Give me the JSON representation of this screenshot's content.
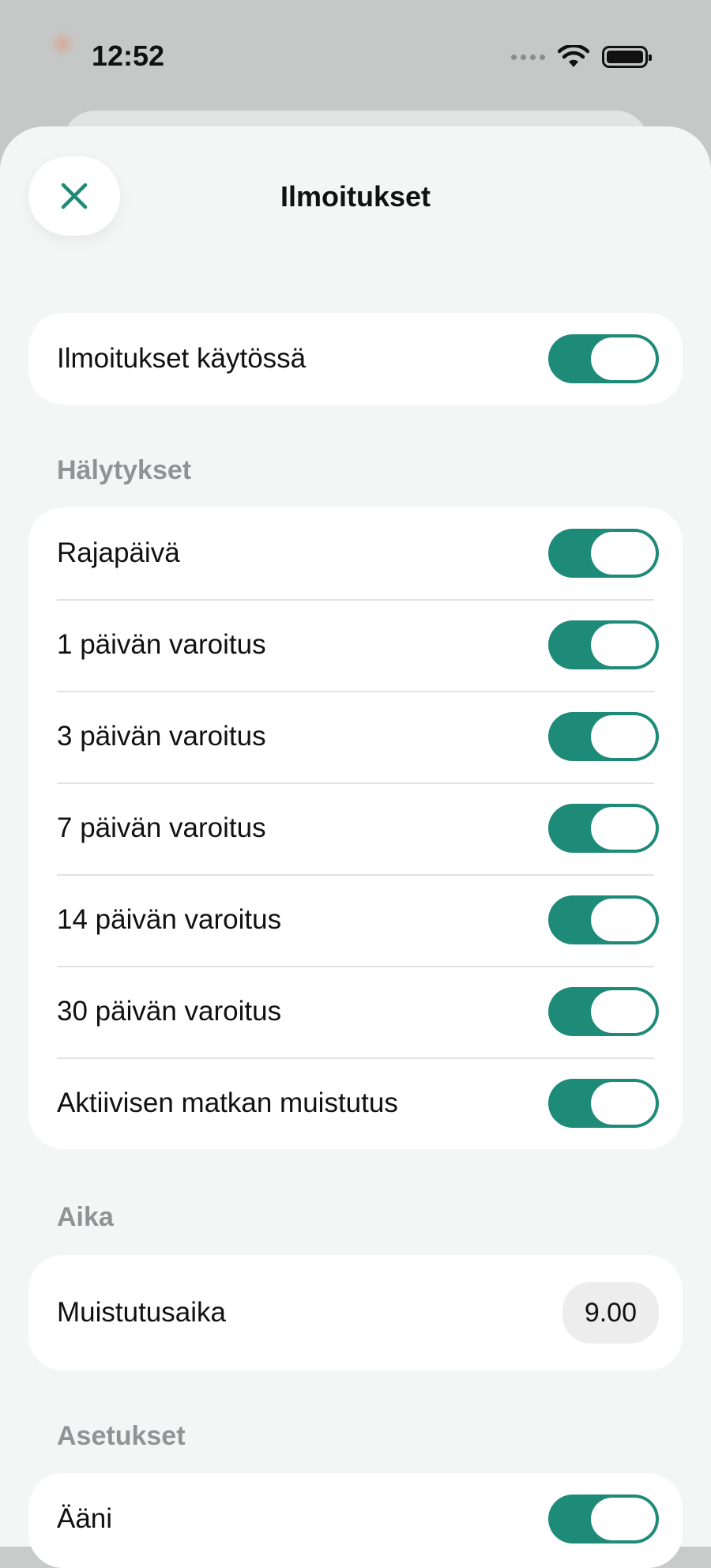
{
  "status_bar": {
    "time": "12:52"
  },
  "sheet": {
    "title": "Ilmoitukset",
    "close_icon": "close-icon",
    "accent_color": "#1e8a78"
  },
  "master": {
    "label": "Ilmoitukset käytössä",
    "enabled": true
  },
  "alerts": {
    "header": "Hälytykset",
    "items": [
      {
        "label": "Rajapäivä",
        "enabled": true
      },
      {
        "label": "1 päivän varoitus",
        "enabled": true
      },
      {
        "label": "3 päivän varoitus",
        "enabled": true
      },
      {
        "label": "7 päivän varoitus",
        "enabled": true
      },
      {
        "label": "14 päivän varoitus",
        "enabled": true
      },
      {
        "label": "30 päivän varoitus",
        "enabled": true
      },
      {
        "label": "Aktiivisen matkan muistutus",
        "enabled": true
      }
    ]
  },
  "time_section": {
    "header": "Aika",
    "reminder_label": "Muistutusaika",
    "reminder_value": "9.00"
  },
  "settings": {
    "header": "Asetukset",
    "items": [
      {
        "label": "Ääni",
        "enabled": true
      }
    ]
  }
}
